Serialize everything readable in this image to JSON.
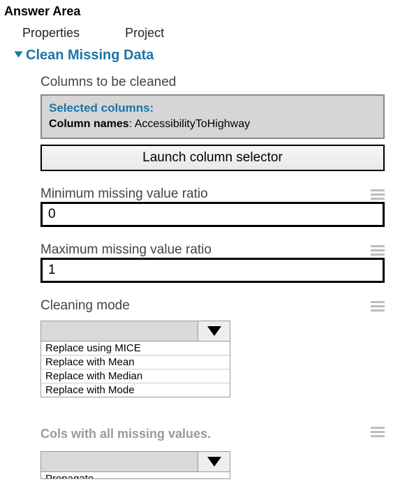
{
  "heading": "Answer Area",
  "tabs": {
    "properties": "Properties",
    "project": "Project"
  },
  "section_title": "Clean Missing Data",
  "columns": {
    "label": "Columns to be cleaned",
    "selected_title": "Selected columns:",
    "names_key": "Column names",
    "names_value": ": AccessibilityToHighway",
    "launch": "Launch column selector"
  },
  "min_ratio": {
    "label": "Minimum missing value ratio",
    "value": "0"
  },
  "max_ratio": {
    "label": "Maximum missing value ratio",
    "value": "1"
  },
  "cleaning_mode": {
    "label": "Cleaning mode",
    "selected": "",
    "options": [
      "Replace using MICE",
      "Replace with Mean",
      "Replace with Median",
      "Replace with Mode"
    ]
  },
  "cols_all_missing": {
    "label": "Cols with all missing values.",
    "selected": "",
    "partial_option": "Propagate"
  }
}
